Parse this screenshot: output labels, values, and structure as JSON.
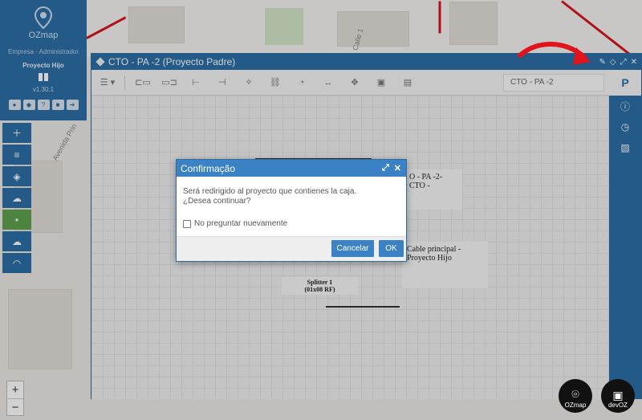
{
  "sidebar": {
    "brand": "OZmap",
    "company": "Empresa - Administrador",
    "project": "Proyecto Hijo",
    "version": "v1.30.1"
  },
  "map": {
    "street_labels": [
      "Avenida Prin",
      "Calle 1"
    ]
  },
  "window": {
    "title": "CTO - PA -2 (Proyecto Padre)",
    "search_value": "CTO - PA -2"
  },
  "canvas": {
    "card_cto": "O - PA -2-CTO -",
    "card_cable": "Cable principal - Proyecto Hijo",
    "card_splitter_line1": "Splitter 1",
    "card_splitter_line2": "(01x08 RF)"
  },
  "modal": {
    "title": "Confirmação",
    "message_line1": "Será redirigido al proyecto que contienes la caja.",
    "message_line2": "¿Desea continuar?",
    "checkbox_label": "No preguntar nuevamente",
    "cancel_label": "Cancelar",
    "ok_label": "OK"
  },
  "badges": {
    "ozmap": "OZmap",
    "devoz": "devOZ"
  },
  "colors": {
    "primary": "#2d6ea5",
    "modal_header": "#3b82c4",
    "active_tool": "#5fa14d",
    "arrow": "#e0141a"
  }
}
